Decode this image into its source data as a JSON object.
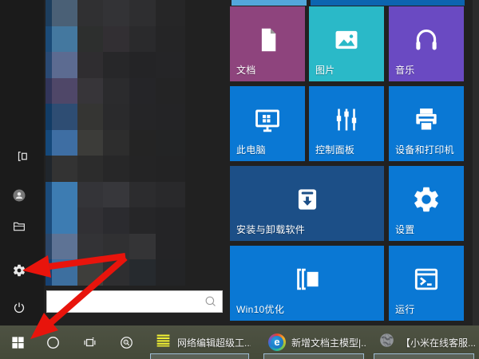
{
  "app": {
    "name": "Windows 10 Start Menu",
    "language": "zh-CN"
  },
  "colors": {
    "accent_blue": "#0a78d4",
    "menu_bg": "#212121",
    "rail_bg": "#1b1b1b",
    "taskbar_bg": "#4a4f3e",
    "arrow_red": "#e8140c",
    "tile_text": "#ffffff"
  },
  "start_menu": {
    "sidebar": {
      "items": [
        {
          "id": "expand",
          "icon": "expand-icon"
        },
        {
          "id": "user-account",
          "icon": "user-avatar-icon"
        },
        {
          "id": "file-explorer",
          "icon": "file-explorer-icon"
        },
        {
          "id": "settings",
          "icon": "settings-gear-icon"
        },
        {
          "id": "power",
          "icon": "power-icon"
        }
      ]
    },
    "search": {
      "value": "",
      "placeholder": "",
      "icon": "search-icon"
    },
    "tiles": [
      {
        "id": "partial-tile-small",
        "label": "",
        "icon": "",
        "color": "#53a7db",
        "col": 0,
        "row": -1,
        "colspan": 1,
        "partial": true
      },
      {
        "id": "partial-tile-wide",
        "label": "",
        "icon": "",
        "color": "#0c64b0",
        "col": 1,
        "row": -1,
        "colspan": 2,
        "partial": true
      },
      {
        "id": "documents",
        "label": "文档",
        "icon": "document-icon",
        "color": "#8e447d",
        "col": 0,
        "row": 0,
        "colspan": 1
      },
      {
        "id": "pictures",
        "label": "图片",
        "icon": "pictures-icon",
        "color": "#2ab9c8",
        "col": 1,
        "row": 0,
        "colspan": 1
      },
      {
        "id": "music",
        "label": "音乐",
        "icon": "music-icon",
        "color": "#6a4ac2",
        "col": 2,
        "row": 0,
        "colspan": 1
      },
      {
        "id": "this-pc",
        "label": "此电脑",
        "icon": "this-pc-icon",
        "color": "#0a78d4",
        "col": 0,
        "row": 1,
        "colspan": 1
      },
      {
        "id": "control-panel",
        "label": "控制面板",
        "icon": "control-panel-icon",
        "color": "#0a78d4",
        "col": 1,
        "row": 1,
        "colspan": 1
      },
      {
        "id": "devices-printers",
        "label": "设备和打印机",
        "icon": "printer-icon",
        "color": "#0a78d4",
        "col": 2,
        "row": 1,
        "colspan": 1
      },
      {
        "id": "install-uninstall",
        "label": "安装与卸载软件",
        "icon": "install-box-icon",
        "color": "#1c4f87",
        "col": 0,
        "row": 2,
        "colspan": 2
      },
      {
        "id": "settings-tile",
        "label": "设置",
        "icon": "settings-gear-filled-icon",
        "color": "#0a78d4",
        "col": 2,
        "row": 2,
        "colspan": 1
      },
      {
        "id": "win10-optimize",
        "label": "Win10优化",
        "icon": "win10-optimize-icon",
        "color": "#0a78d4",
        "col": 0,
        "row": 3,
        "colspan": 2
      },
      {
        "id": "run",
        "label": "运行",
        "icon": "run-icon",
        "color": "#0a78d4",
        "col": 2,
        "row": 3,
        "colspan": 1
      }
    ],
    "censored_mosaic": {
      "description": "pixelated (censored) app list",
      "rows": [
        [
          "#1d3e5e",
          "#4a6076",
          "#303032",
          "#333336",
          "#2e2e30",
          "#262627"
        ],
        [
          "#1b4b78",
          "#44789f",
          "#2d2f2e",
          "#322f33",
          "#2a2a2c",
          "#252526"
        ],
        [
          "#2a4a74",
          "#5c6b91",
          "#2f2d30",
          "#272729",
          "#242426",
          "#252527"
        ],
        [
          "#32355a",
          "#4f4768",
          "#373539",
          "#2b2b2d",
          "#252528",
          "#242425"
        ],
        [
          "#123c66",
          "#2e4d73",
          "#353533",
          "#2a2a2c",
          "#252527",
          "#242426"
        ],
        [
          "#15497b",
          "#3e6ea3",
          "#3c3c39",
          "#2d2d2d",
          "#242424",
          "#232425"
        ],
        [
          "#20262c",
          "#333333",
          "#2c2c2c",
          "#272728",
          "#242425",
          "#232324"
        ],
        [
          "#1b4c7c",
          "#3d7cb2",
          "#343438",
          "#37373b",
          "#2c2c2e",
          "#29292b"
        ],
        [
          "#1b4c7c",
          "#3d7cb2",
          "#313034",
          "#2b2b2f",
          "#262628",
          "#242426"
        ],
        [
          "#2c4668",
          "#5e7395",
          "#333336",
          "#303032",
          "#343436",
          "#242426"
        ],
        [
          "#174273",
          "#3d6f9f",
          "#3e3e3b",
          "#2e2e30",
          "#262a2e",
          "#232426"
        ]
      ]
    }
  },
  "taskbar": {
    "start_button": {
      "id": "start",
      "icon": "windows-logo-icon"
    },
    "system_buttons": [
      {
        "id": "cortana",
        "icon": "circle-icon"
      },
      {
        "id": "task-view",
        "icon": "task-view-icon"
      },
      {
        "id": "magnifier",
        "icon": "magnifier-circle-icon"
      }
    ],
    "apps": [
      {
        "id": "app-net-editor",
        "label": "网络编辑超级工...",
        "icon": "yellow-list-icon",
        "open": true
      },
      {
        "id": "app-doc-model",
        "label": "新增文档主模型|...",
        "icon": "e-browser-icon",
        "open": true
      },
      {
        "id": "app-mi-service",
        "label": "【小米在线客服...",
        "icon": "globe-icon",
        "open": true
      }
    ]
  },
  "annotations": {
    "arrows": [
      {
        "id": "arrow-to-settings",
        "points_to": "sidebar settings gear",
        "color": "#e8140c"
      },
      {
        "id": "arrow-to-start",
        "points_to": "taskbar start button",
        "color": "#e8140c"
      }
    ]
  }
}
